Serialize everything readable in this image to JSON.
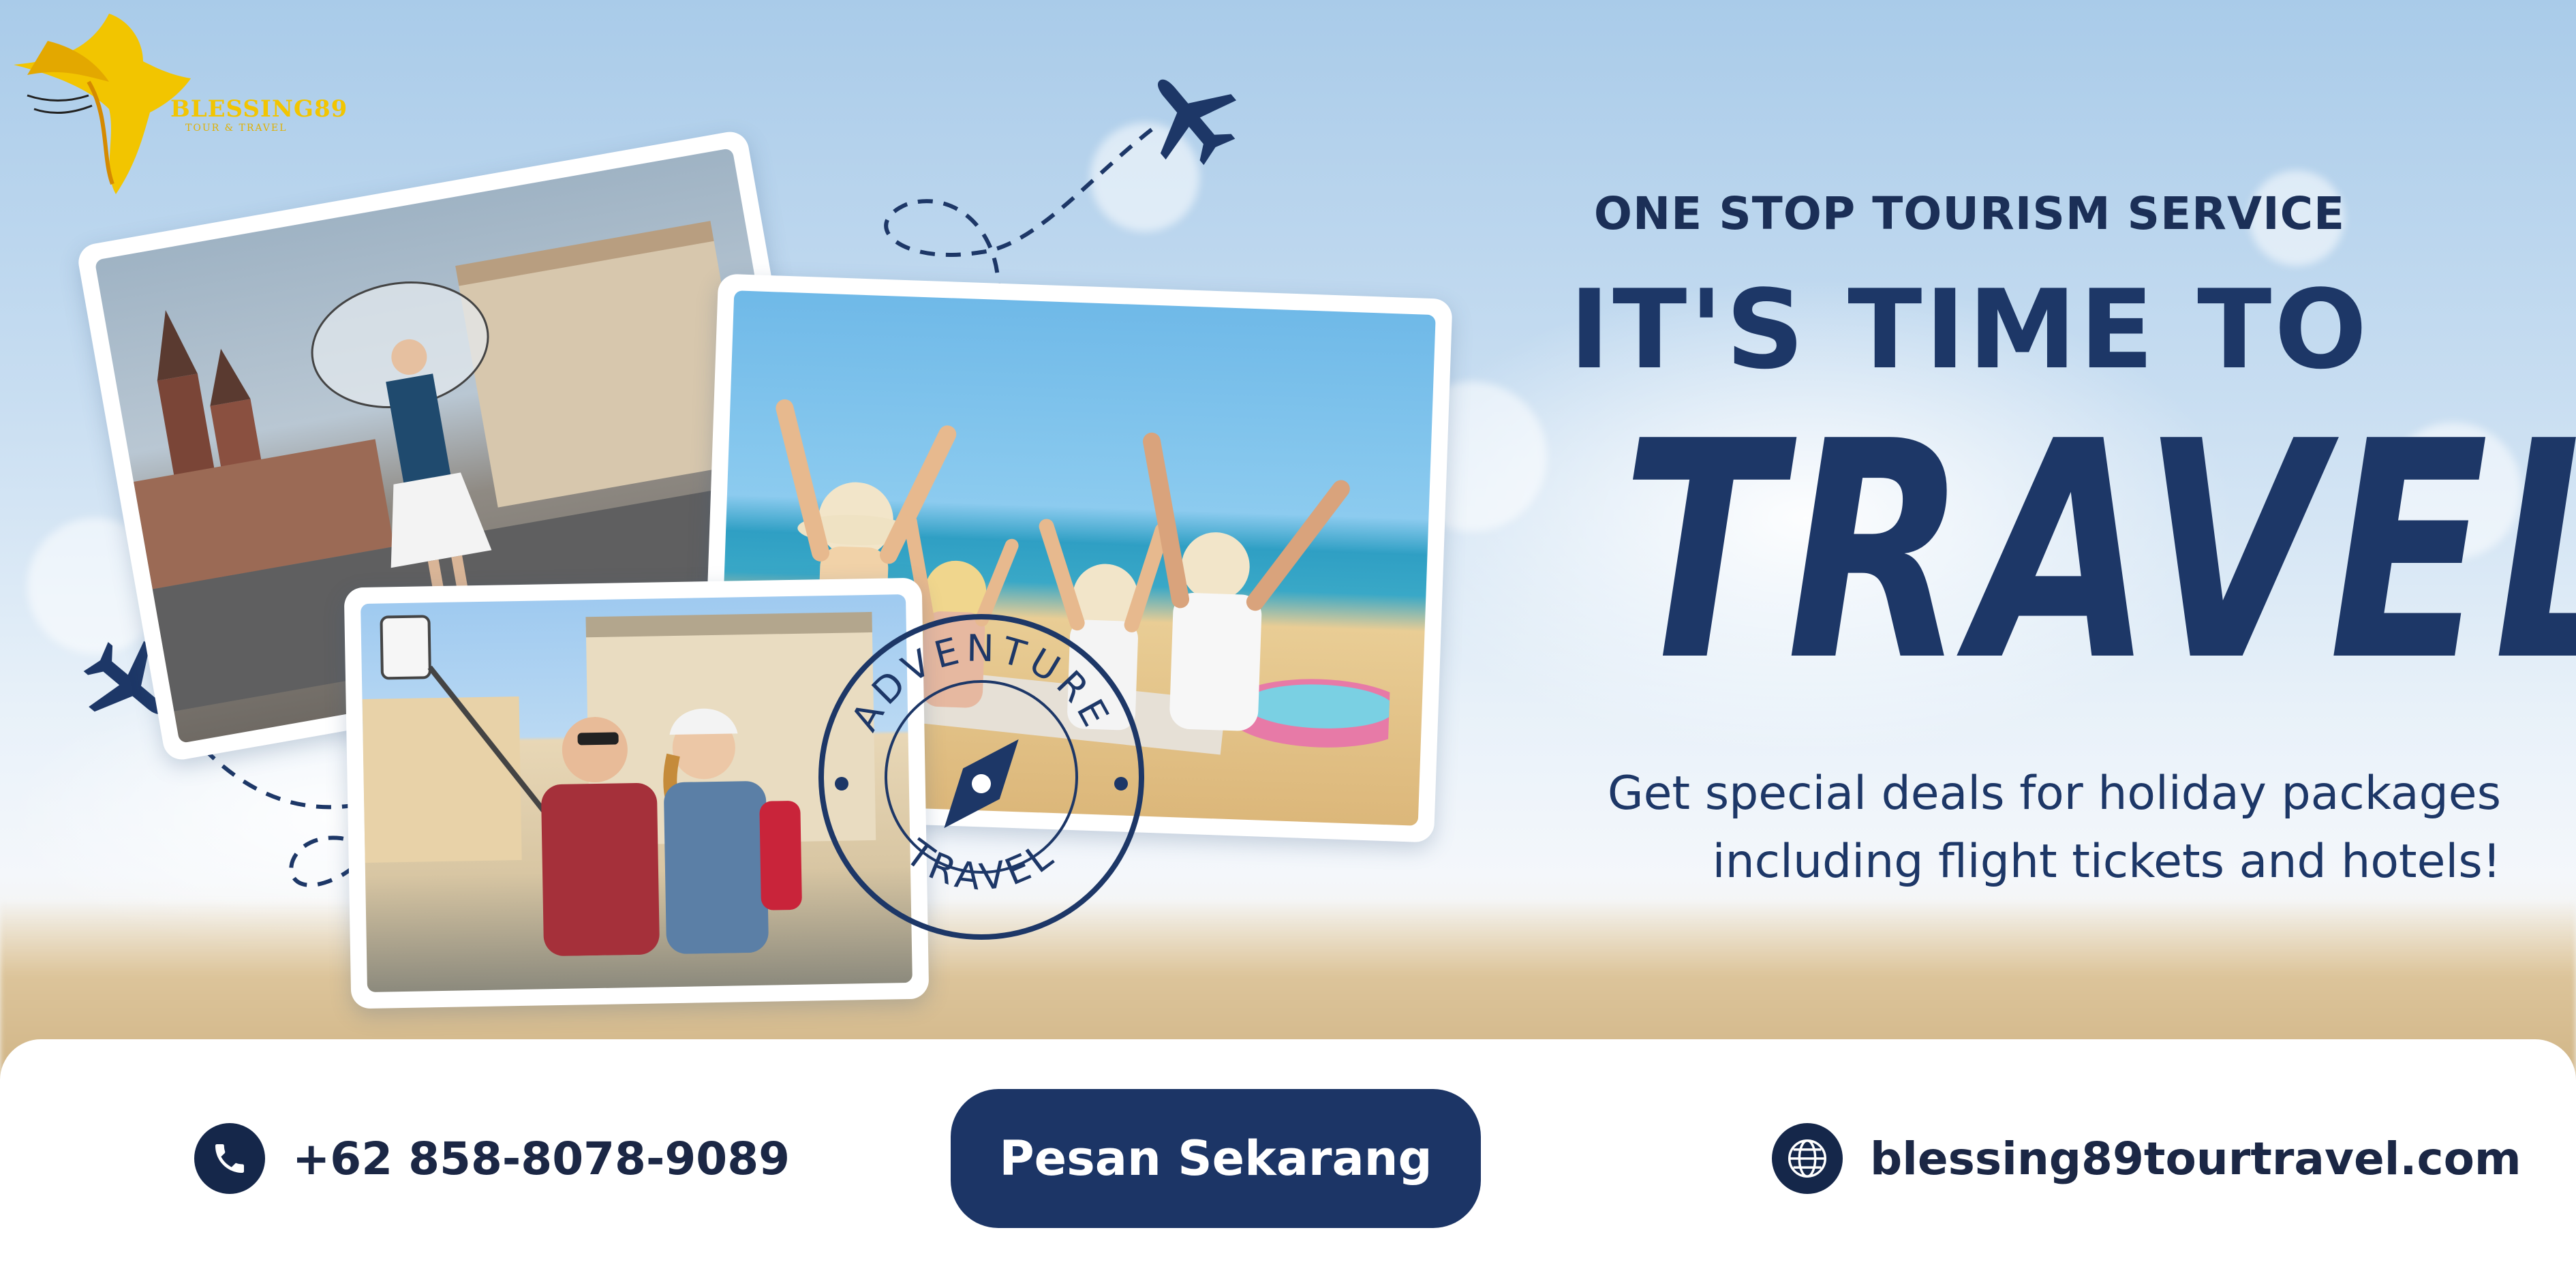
{
  "brand": {
    "name": "BLESSING89",
    "subtitle": "TOUR & TRAVEL",
    "colors": {
      "gold": "#f2c500",
      "navy": "#1d3767"
    }
  },
  "hero": {
    "eyebrow": "ONE STOP TOURISM SERVICE",
    "headline_top": "IT'S TIME TO",
    "headline_main": "TRAVEL",
    "tagline_line1": "Get special deals for holiday packages",
    "tagline_line2": "including flight tickets and hotels!"
  },
  "stamp": {
    "top_text": "ADVENTURE",
    "bottom_text": "TRAVEL"
  },
  "icons": {
    "airplane": "airplane-icon",
    "phone": "phone-icon",
    "globe": "globe-icon",
    "compass": "compass-icon"
  },
  "footer": {
    "phone": "+62 858-8078-9089",
    "cta_label": "Pesan Sekarang",
    "website": "blessing89tourtravel.com"
  }
}
